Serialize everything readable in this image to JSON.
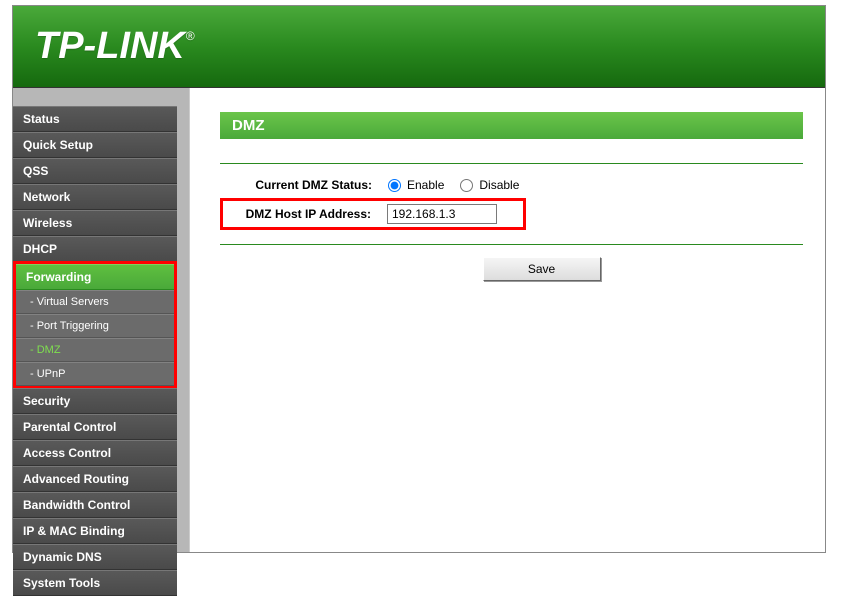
{
  "brand": "TP-LINK",
  "sidebar": {
    "items": [
      {
        "label": "Status",
        "type": "item"
      },
      {
        "label": "Quick Setup",
        "type": "item"
      },
      {
        "label": "QSS",
        "type": "item"
      },
      {
        "label": "Network",
        "type": "item"
      },
      {
        "label": "Wireless",
        "type": "item"
      },
      {
        "label": "DHCP",
        "type": "item"
      },
      {
        "label": "Forwarding",
        "type": "item-active"
      },
      {
        "label": "- Virtual Servers",
        "type": "sub"
      },
      {
        "label": "- Port Triggering",
        "type": "sub"
      },
      {
        "label": "- DMZ",
        "type": "sub-active"
      },
      {
        "label": "- UPnP",
        "type": "sub"
      },
      {
        "label": "Security",
        "type": "item"
      },
      {
        "label": "Parental Control",
        "type": "item"
      },
      {
        "label": "Access Control",
        "type": "item"
      },
      {
        "label": "Advanced Routing",
        "type": "item"
      },
      {
        "label": "Bandwidth Control",
        "type": "item"
      },
      {
        "label": "IP & MAC Binding",
        "type": "item"
      },
      {
        "label": "Dynamic DNS",
        "type": "item"
      },
      {
        "label": "System Tools",
        "type": "item"
      }
    ]
  },
  "page": {
    "title": "DMZ",
    "status_label": "Current DMZ Status:",
    "enable_label": "Enable",
    "disable_label": "Disable",
    "status_value": "enable",
    "ip_label": "DMZ Host IP Address:",
    "ip_value": "192.168.1.3",
    "save_label": "Save"
  }
}
